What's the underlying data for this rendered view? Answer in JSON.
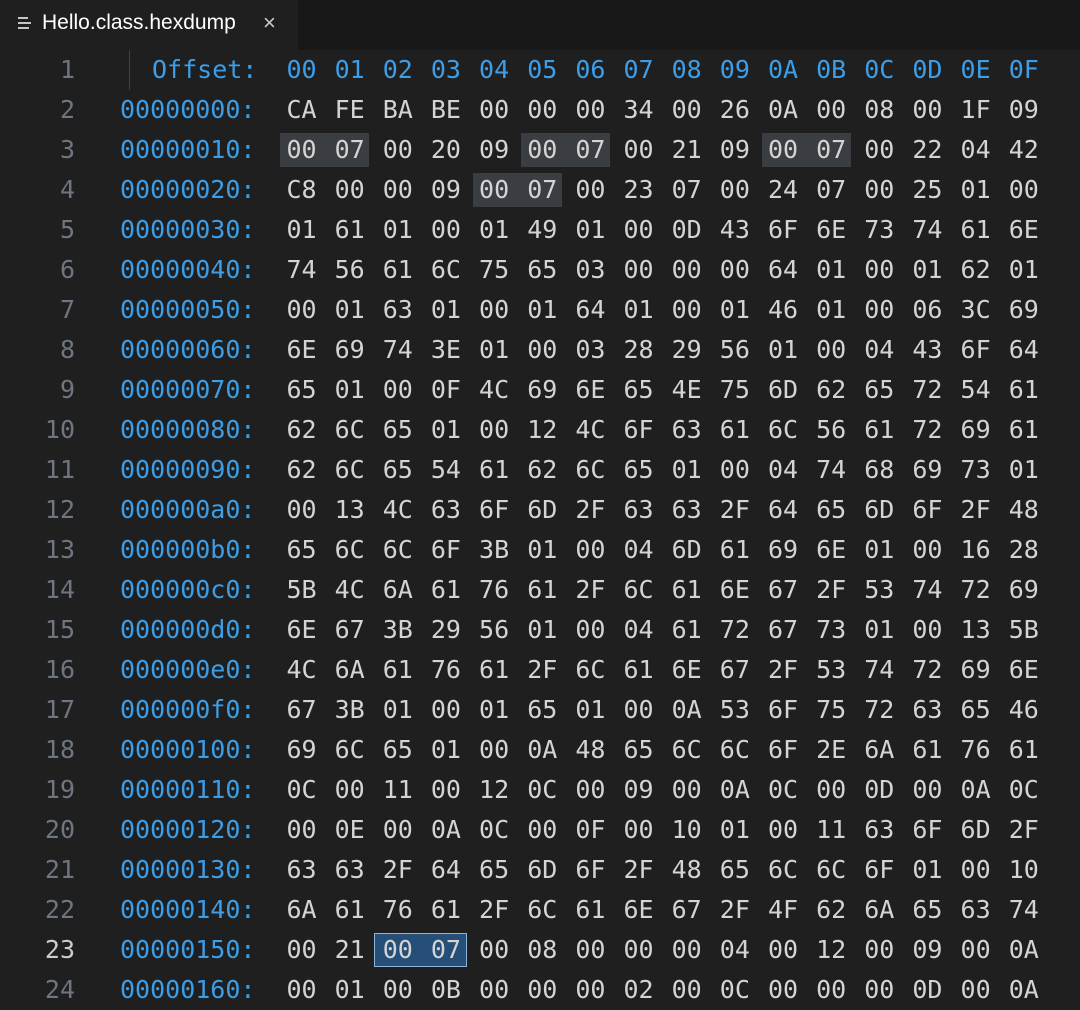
{
  "tab": {
    "title": "Hello.class.hexdump",
    "close": "×",
    "icon": "file-lines-icon"
  },
  "header": {
    "line": "1",
    "label": "Offset:",
    "columns": [
      "00",
      "01",
      "02",
      "03",
      "04",
      "05",
      "06",
      "07",
      "08",
      "09",
      "0A",
      "0B",
      "0C",
      "0D",
      "0E",
      "0F"
    ]
  },
  "rows": [
    {
      "line": "2",
      "addr": "00000000:",
      "bytes": [
        "CA",
        "FE",
        "BA",
        "BE",
        "00",
        "00",
        "00",
        "34",
        "00",
        "26",
        "0A",
        "00",
        "08",
        "00",
        "1F",
        "09"
      ]
    },
    {
      "line": "3",
      "addr": "00000010:",
      "bytes": [
        "00",
        "07",
        "00",
        "20",
        "09",
        "00",
        "07",
        "00",
        "21",
        "09",
        "00",
        "07",
        "00",
        "22",
        "04",
        "42"
      ]
    },
    {
      "line": "4",
      "addr": "00000020:",
      "bytes": [
        "C8",
        "00",
        "00",
        "09",
        "00",
        "07",
        "00",
        "23",
        "07",
        "00",
        "24",
        "07",
        "00",
        "25",
        "01",
        "00"
      ]
    },
    {
      "line": "5",
      "addr": "00000030:",
      "bytes": [
        "01",
        "61",
        "01",
        "00",
        "01",
        "49",
        "01",
        "00",
        "0D",
        "43",
        "6F",
        "6E",
        "73",
        "74",
        "61",
        "6E"
      ]
    },
    {
      "line": "6",
      "addr": "00000040:",
      "bytes": [
        "74",
        "56",
        "61",
        "6C",
        "75",
        "65",
        "03",
        "00",
        "00",
        "00",
        "64",
        "01",
        "00",
        "01",
        "62",
        "01"
      ]
    },
    {
      "line": "7",
      "addr": "00000050:",
      "bytes": [
        "00",
        "01",
        "63",
        "01",
        "00",
        "01",
        "64",
        "01",
        "00",
        "01",
        "46",
        "01",
        "00",
        "06",
        "3C",
        "69"
      ]
    },
    {
      "line": "8",
      "addr": "00000060:",
      "bytes": [
        "6E",
        "69",
        "74",
        "3E",
        "01",
        "00",
        "03",
        "28",
        "29",
        "56",
        "01",
        "00",
        "04",
        "43",
        "6F",
        "64"
      ]
    },
    {
      "line": "9",
      "addr": "00000070:",
      "bytes": [
        "65",
        "01",
        "00",
        "0F",
        "4C",
        "69",
        "6E",
        "65",
        "4E",
        "75",
        "6D",
        "62",
        "65",
        "72",
        "54",
        "61"
      ]
    },
    {
      "line": "10",
      "addr": "00000080:",
      "bytes": [
        "62",
        "6C",
        "65",
        "01",
        "00",
        "12",
        "4C",
        "6F",
        "63",
        "61",
        "6C",
        "56",
        "61",
        "72",
        "69",
        "61"
      ]
    },
    {
      "line": "11",
      "addr": "00000090:",
      "bytes": [
        "62",
        "6C",
        "65",
        "54",
        "61",
        "62",
        "6C",
        "65",
        "01",
        "00",
        "04",
        "74",
        "68",
        "69",
        "73",
        "01"
      ]
    },
    {
      "line": "12",
      "addr": "000000a0:",
      "bytes": [
        "00",
        "13",
        "4C",
        "63",
        "6F",
        "6D",
        "2F",
        "63",
        "63",
        "2F",
        "64",
        "65",
        "6D",
        "6F",
        "2F",
        "48"
      ]
    },
    {
      "line": "13",
      "addr": "000000b0:",
      "bytes": [
        "65",
        "6C",
        "6C",
        "6F",
        "3B",
        "01",
        "00",
        "04",
        "6D",
        "61",
        "69",
        "6E",
        "01",
        "00",
        "16",
        "28"
      ]
    },
    {
      "line": "14",
      "addr": "000000c0:",
      "bytes": [
        "5B",
        "4C",
        "6A",
        "61",
        "76",
        "61",
        "2F",
        "6C",
        "61",
        "6E",
        "67",
        "2F",
        "53",
        "74",
        "72",
        "69"
      ]
    },
    {
      "line": "15",
      "addr": "000000d0:",
      "bytes": [
        "6E",
        "67",
        "3B",
        "29",
        "56",
        "01",
        "00",
        "04",
        "61",
        "72",
        "67",
        "73",
        "01",
        "00",
        "13",
        "5B"
      ]
    },
    {
      "line": "16",
      "addr": "000000e0:",
      "bytes": [
        "4C",
        "6A",
        "61",
        "76",
        "61",
        "2F",
        "6C",
        "61",
        "6E",
        "67",
        "2F",
        "53",
        "74",
        "72",
        "69",
        "6E"
      ]
    },
    {
      "line": "17",
      "addr": "000000f0:",
      "bytes": [
        "67",
        "3B",
        "01",
        "00",
        "01",
        "65",
        "01",
        "00",
        "0A",
        "53",
        "6F",
        "75",
        "72",
        "63",
        "65",
        "46"
      ]
    },
    {
      "line": "18",
      "addr": "00000100:",
      "bytes": [
        "69",
        "6C",
        "65",
        "01",
        "00",
        "0A",
        "48",
        "65",
        "6C",
        "6C",
        "6F",
        "2E",
        "6A",
        "61",
        "76",
        "61"
      ]
    },
    {
      "line": "19",
      "addr": "00000110:",
      "bytes": [
        "0C",
        "00",
        "11",
        "00",
        "12",
        "0C",
        "00",
        "09",
        "00",
        "0A",
        "0C",
        "00",
        "0D",
        "00",
        "0A",
        "0C"
      ]
    },
    {
      "line": "20",
      "addr": "00000120:",
      "bytes": [
        "00",
        "0E",
        "00",
        "0A",
        "0C",
        "00",
        "0F",
        "00",
        "10",
        "01",
        "00",
        "11",
        "63",
        "6F",
        "6D",
        "2F"
      ]
    },
    {
      "line": "21",
      "addr": "00000130:",
      "bytes": [
        "63",
        "63",
        "2F",
        "64",
        "65",
        "6D",
        "6F",
        "2F",
        "48",
        "65",
        "6C",
        "6C",
        "6F",
        "01",
        "00",
        "10"
      ]
    },
    {
      "line": "22",
      "addr": "00000140:",
      "bytes": [
        "6A",
        "61",
        "76",
        "61",
        "2F",
        "6C",
        "61",
        "6E",
        "67",
        "2F",
        "4F",
        "62",
        "6A",
        "65",
        "63",
        "74"
      ]
    },
    {
      "line": "23",
      "addr": "00000150:",
      "bytes": [
        "00",
        "21",
        "00",
        "07",
        "00",
        "08",
        "00",
        "00",
        "00",
        "04",
        "00",
        "12",
        "00",
        "09",
        "00",
        "0A"
      ]
    },
    {
      "line": "24",
      "addr": "00000160:",
      "bytes": [
        "00",
        "01",
        "00",
        "0B",
        "00",
        "00",
        "00",
        "02",
        "00",
        "0C",
        "00",
        "00",
        "00",
        "0D",
        "00",
        "0A"
      ]
    }
  ],
  "active_line": "23",
  "colors": {
    "background": "#1f1f1f",
    "address": "#3c9ee8",
    "bytes": "#d4d4d4",
    "highlight": "#3a3d41",
    "selection": "#264f78"
  }
}
